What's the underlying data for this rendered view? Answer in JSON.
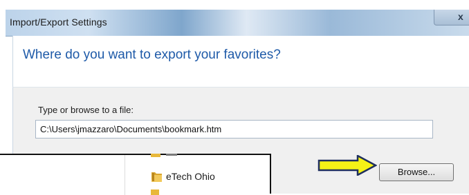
{
  "window": {
    "title": "Import/Export Settings",
    "close_glyph": "x"
  },
  "header": {
    "heading": "Where do you want to export your favorites?"
  },
  "form": {
    "file_label": "Type or browse to a file:",
    "file_path": "C:\\Users\\jmazzaro\\Documents\\bookmark.htm",
    "browse_label": "Browse..."
  },
  "overlay": {
    "folder_label": "eTech Ohio",
    "folder_icon": "folder-icon"
  },
  "annotation": {
    "arrow_color": "#f5f216",
    "arrow_outline": "#1f2f5e"
  },
  "colors": {
    "heading": "#1e5aa8",
    "content_bg": "#f0f0f0",
    "folder_yellow": "#e8b83a"
  }
}
